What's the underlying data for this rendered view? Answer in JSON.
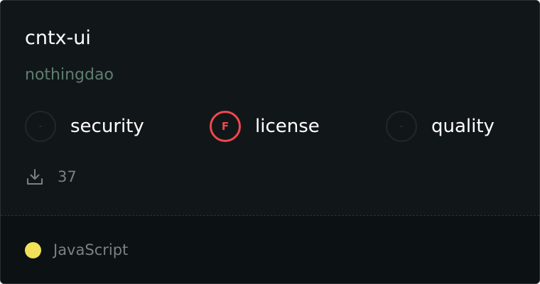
{
  "package": {
    "name": "cntx-ui",
    "owner": "nothingdao"
  },
  "scores": [
    {
      "label": "security",
      "grade": "-",
      "status": "none"
    },
    {
      "label": "license",
      "grade": "F",
      "status": "fail"
    },
    {
      "label": "quality",
      "grade": "-",
      "status": "none"
    }
  ],
  "downloads": {
    "icon": "download-icon",
    "count": "37"
  },
  "language": {
    "name": "JavaScript",
    "color": "#f1e05a"
  },
  "colors": {
    "background": "#111719",
    "footer_background": "#0c1113",
    "owner_text": "#5f7d70",
    "fail_red": "#f2474d"
  }
}
